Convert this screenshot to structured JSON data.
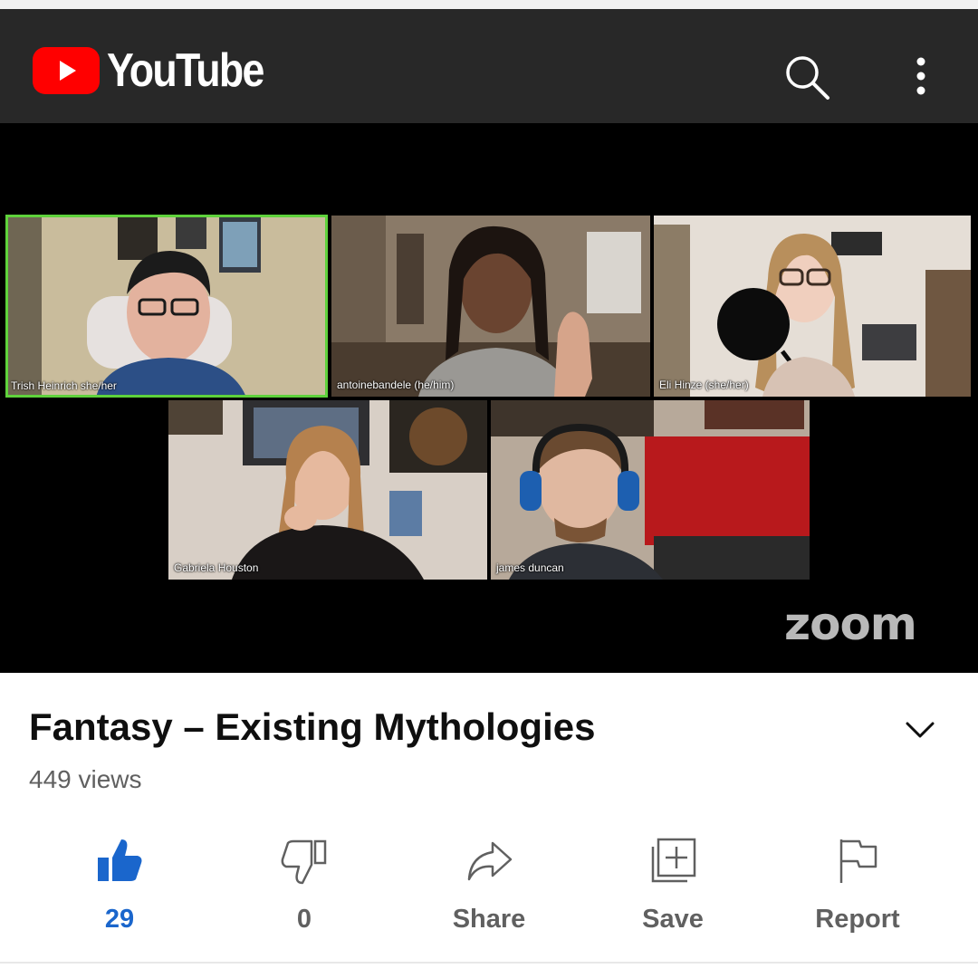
{
  "header": {
    "brand_text": "YouTube",
    "brand_color": "#ff0000",
    "background": "#282828",
    "search_icon": "search-icon",
    "menu_icon": "more-vert-icon"
  },
  "player": {
    "watermark": "zoom",
    "participants": [
      {
        "name": "Trish Heinrich she/her",
        "active": true
      },
      {
        "name": "antoinebandele (he/him)",
        "active": false
      },
      {
        "name": "Eli Hinze (she/her)",
        "active": false
      },
      {
        "name": "Gabriela Houston",
        "active": false
      },
      {
        "name": "james duncan",
        "active": false
      }
    ]
  },
  "video": {
    "title": "Fantasy – Existing Mythologies",
    "views": "449 views"
  },
  "actions": {
    "like": {
      "label": "29",
      "icon": "thumbs-up-icon",
      "active": true,
      "color": "#1a66cc"
    },
    "dislike": {
      "label": "0",
      "icon": "thumbs-down-icon"
    },
    "share": {
      "label": "Share",
      "icon": "share-icon"
    },
    "save": {
      "label": "Save",
      "icon": "playlist-add-icon"
    },
    "report": {
      "label": "Report",
      "icon": "flag-icon"
    }
  }
}
